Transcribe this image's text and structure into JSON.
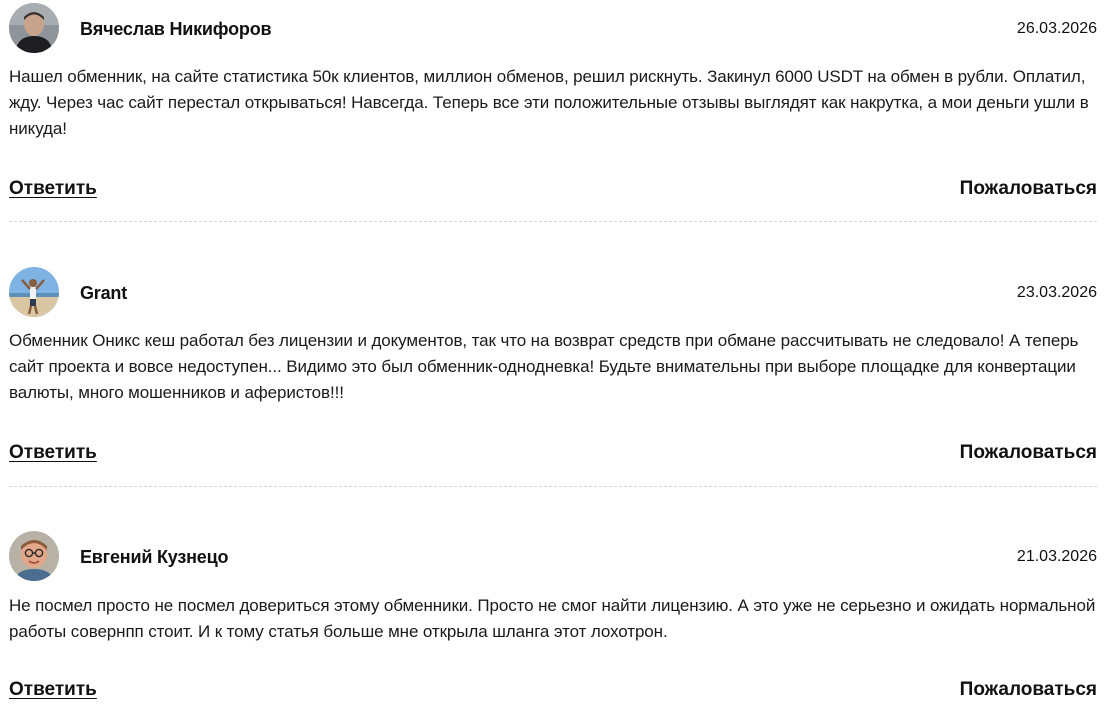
{
  "comments": [
    {
      "author": "Вячеслав Никифоров",
      "date": "26.03.2026",
      "text": "Нашел обменник, на сайте статистика 50к клиентов, миллион обменов, решил рискнуть. Закинул 6000 USDT на обмен в рубли. Оплатил, жду. Через час сайт перестал открываться! Навсегда. Теперь все эти положительные отзывы выглядят как накрутка, а мои деньги ушли в никуда!",
      "reply_label": "Ответить",
      "report_label": "Пожаловаться",
      "avatar": "avatar-man-dark-shirt"
    },
    {
      "author": "Grant",
      "date": "23.03.2026",
      "text": "Обменник Оникс кеш работал без лицензии и документов, так что на возврат средств при обмане рассчитывать не следовало! А теперь сайт проекта и вовсе недоступен... Видимо это был обменник-однодневка! Будьте внимательны при выборе площадке для конвертации валюты, много мошенников и аферистов!!!",
      "reply_label": "Ответить",
      "report_label": "Пожаловаться",
      "avatar": "avatar-beach-person"
    },
    {
      "author": "Евгений Кузнецо",
      "date": "21.03.2026",
      "text": "Не посмел просто не посмел довериться этому обменники. Просто не смог найти лицензию. А это уже не серьезно и ожидать нормальной работы совернпп стоит. И к тому статья больше мне открыла шланга этот лохотрон.",
      "reply_label": "Ответить",
      "report_label": "Пожаловаться",
      "avatar": "avatar-man-glasses"
    }
  ]
}
